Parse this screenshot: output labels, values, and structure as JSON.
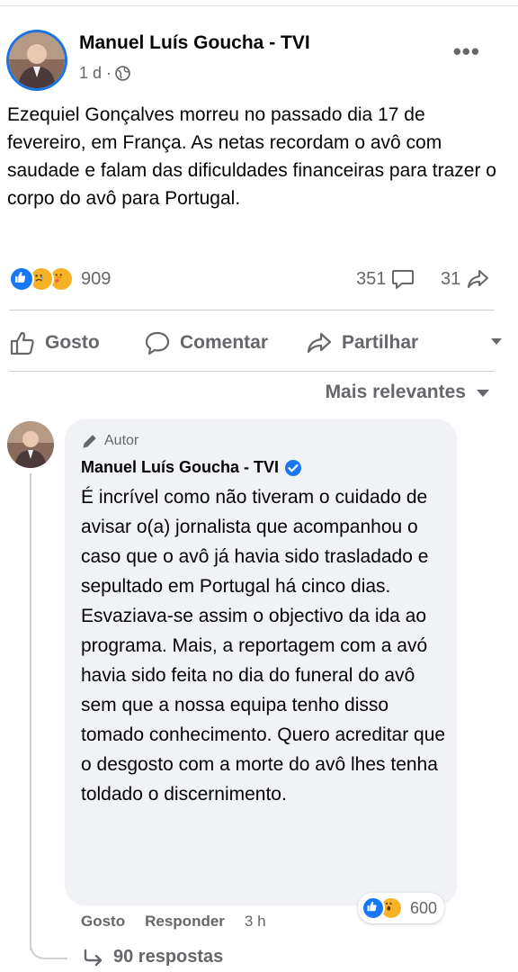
{
  "post": {
    "author": "Manuel Luís Goucha - TVI",
    "time": "1 d ·",
    "text": "Ezequiel Gonçalves morreu no passado dia 17 de fevereiro, em França. As netas recordam o avô com saudade e falam das dificuldades financeiras para trazer o corpo do avô para Portugal.",
    "reaction_count": "909",
    "reaction_icons": [
      "like-icon",
      "sad-icon",
      "care-icon"
    ],
    "comment_count": "351",
    "share_count": "31"
  },
  "actions": {
    "like": "Gosto",
    "comment": "Comentar",
    "share": "Partilhar"
  },
  "sort_label": "Mais relevantes",
  "comment": {
    "badge": "Autor",
    "author": "Manuel Luís Goucha - TVI",
    "text": "É incrível como não tiveram o cuidado de avisar o(a) jornalista que acompanhou o caso que o avô já havia sido trasladado e sepultado em Portugal há cinco dias. Esvaziava-se assim o objectivo da ida ao programa. Mais, a reportagem com a avó havia sido feita no dia do funeral do avô sem que a nossa equipa tenho disso tomado conhecimento. Quero acreditar que o desgosto com a morte do avô lhes tenha toldado o discernimento.",
    "reaction_count": "600",
    "reaction_icons": [
      "like-icon",
      "wow-icon"
    ],
    "like_label": "Gosto",
    "reply_label": "Responder",
    "time": "3 h",
    "replies_label": "90 respostas"
  },
  "colors": {
    "facebook_blue": "#1877f2",
    "secondary_text": "#65676b",
    "bubble_bg": "#f0f2f5",
    "reaction_yellow": "#f7b125"
  }
}
